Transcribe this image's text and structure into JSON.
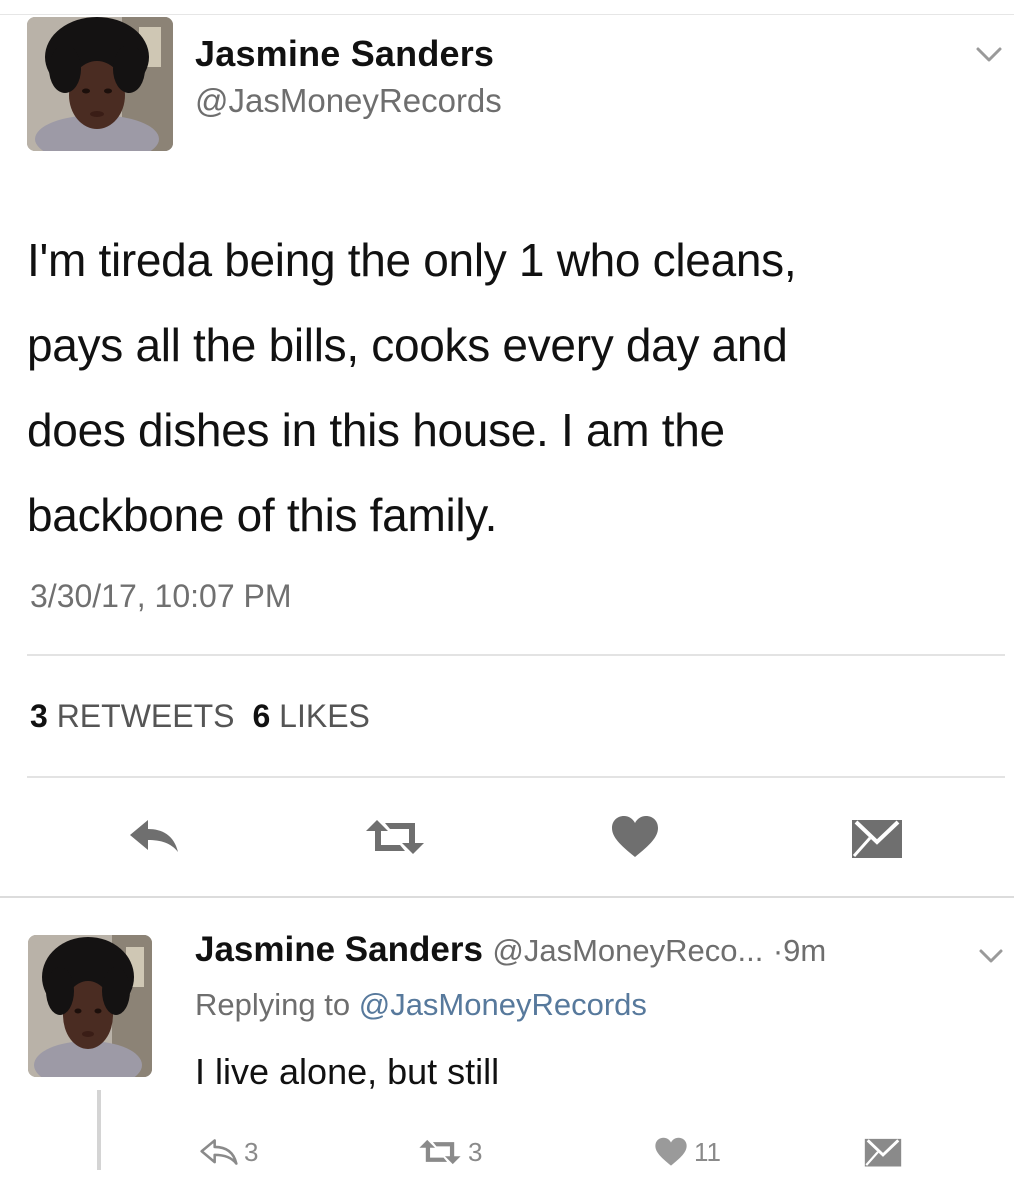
{
  "main_tweet": {
    "name": "Jasmine Sanders",
    "handle": "@JasMoneyRecords",
    "text_lines": [
      "I'm tireda being the only 1 who cleans,",
      "pays all the bills, cooks every day and",
      "does dishes in this house. I am the",
      "backbone of this family."
    ],
    "timestamp": "3/30/17, 10:07 PM",
    "retweets_count": "3",
    "retweets_label": "RETWEETS",
    "likes_count": "6",
    "likes_label": "LIKES",
    "actions": {
      "reply_icon": "reply-icon",
      "retweet_icon": "retweet-icon",
      "like_icon": "heart-icon",
      "message_icon": "envelope-icon"
    }
  },
  "reply_tweet": {
    "name": "Jasmine Sanders",
    "handle": "@JasMoneyReco...",
    "time": "·9m",
    "replying_prefix": "Replying to",
    "replying_mention": "@JasMoneyRecords",
    "text": "I live alone, but still",
    "reply_count": "3",
    "retweet_count": "3",
    "like_count": "11"
  },
  "colors": {
    "text": "#111111",
    "muted": "#6e6e6e",
    "mention": "#57799c",
    "icon": "#707070",
    "divider": "#e3e3e3"
  }
}
